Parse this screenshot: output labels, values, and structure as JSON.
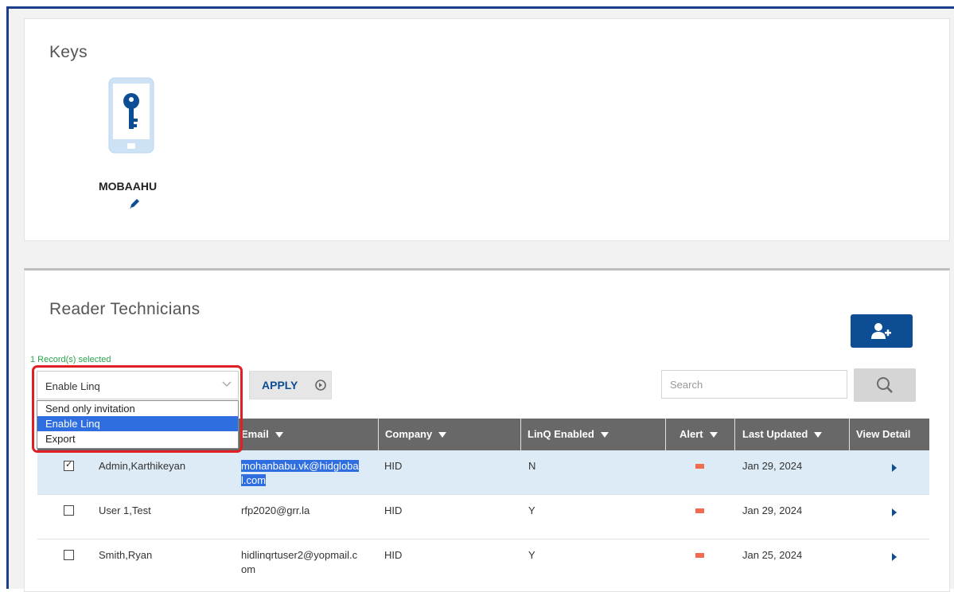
{
  "keys": {
    "title": "Keys",
    "key_name": "MOBAAHU"
  },
  "reader_technicians": {
    "title": "Reader Technicians",
    "records_selected": "1 Record(s) selected",
    "action_select": {
      "value": "Enable Linq",
      "options": [
        "Send only invitation",
        "Enable Linq",
        "Export"
      ],
      "selected_option": "Enable Linq"
    },
    "apply_label": "APPLY",
    "search": {
      "placeholder": "Search",
      "value": ""
    },
    "columns": {
      "email": "Email",
      "company": "Company",
      "linq_enabled": "LinQ Enabled",
      "alert": "Alert",
      "last_updated": "Last Updated",
      "view_detail": "View Detail"
    },
    "rows": [
      {
        "checked": true,
        "name": "Admin,Karthikeyan",
        "email_line1": "mohanbabu.vk@hidgloba",
        "email_line2": "l.com",
        "company": "HID",
        "linq_enabled": "N",
        "last_updated": "Jan 29, 2024"
      },
      {
        "checked": false,
        "name": "User 1,Test",
        "email_line1": "rfp2020@grr.la",
        "email_line2": "",
        "company": "HID",
        "linq_enabled": "Y",
        "last_updated": "Jan 29, 2024"
      },
      {
        "checked": false,
        "name": "Smith,Ryan",
        "email_line1": "hidlinqrtuser2@yopmail.c",
        "email_line2": "om",
        "company": "HID",
        "linq_enabled": "Y",
        "last_updated": "Jan 25, 2024"
      }
    ]
  },
  "colors": {
    "primary": "#0c4d93",
    "header_bg": "#686868",
    "selected_row": "#dcebf5",
    "highlight_border": "#e01e24",
    "records_text": "#29a34a",
    "alert_flag": "#f36b4f"
  },
  "icons": [
    "key-phone-icon",
    "pencil-icon",
    "add-user-icon",
    "arrow-circle-right-icon",
    "search-icon",
    "chevron-down-icon",
    "flag-icon",
    "caret-right-icon",
    "sort-down-icon"
  ]
}
